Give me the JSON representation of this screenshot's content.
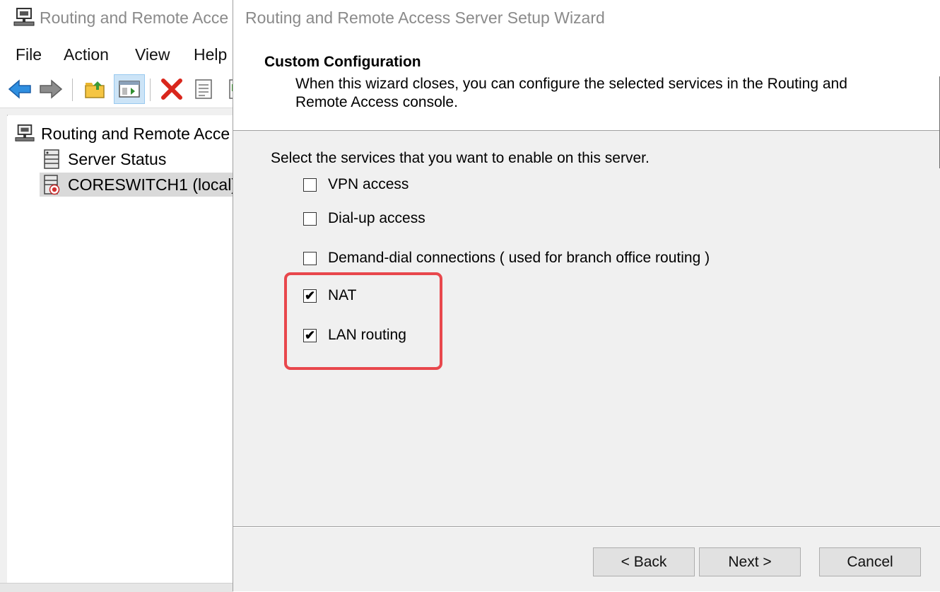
{
  "console": {
    "title": "Routing and Remote Acce",
    "menu": [
      "File",
      "Action",
      "View",
      "Help"
    ],
    "tree": {
      "root": "Routing and Remote Acce",
      "server_status": "Server Status",
      "local_server": "CORESWITCH1 (local)"
    }
  },
  "wizard": {
    "title": "Routing and Remote Access Server Setup Wizard",
    "heading": "Custom Configuration",
    "subtext": "When this wizard closes, you can configure the selected services in the Routing and Remote Access console.",
    "prompt": "Select the services that you want to enable on this server.",
    "options": [
      {
        "label": "VPN access",
        "checked": false
      },
      {
        "label": "Dial-up access",
        "checked": false
      },
      {
        "label": "Demand-dial connections ( used for branch office routing )",
        "checked": false
      },
      {
        "label": "NAT",
        "checked": true
      },
      {
        "label": "LAN routing",
        "checked": true
      }
    ],
    "buttons": {
      "back": "< Back",
      "next": "Next >",
      "cancel": "Cancel"
    },
    "highlight_color": "#e8474c"
  }
}
